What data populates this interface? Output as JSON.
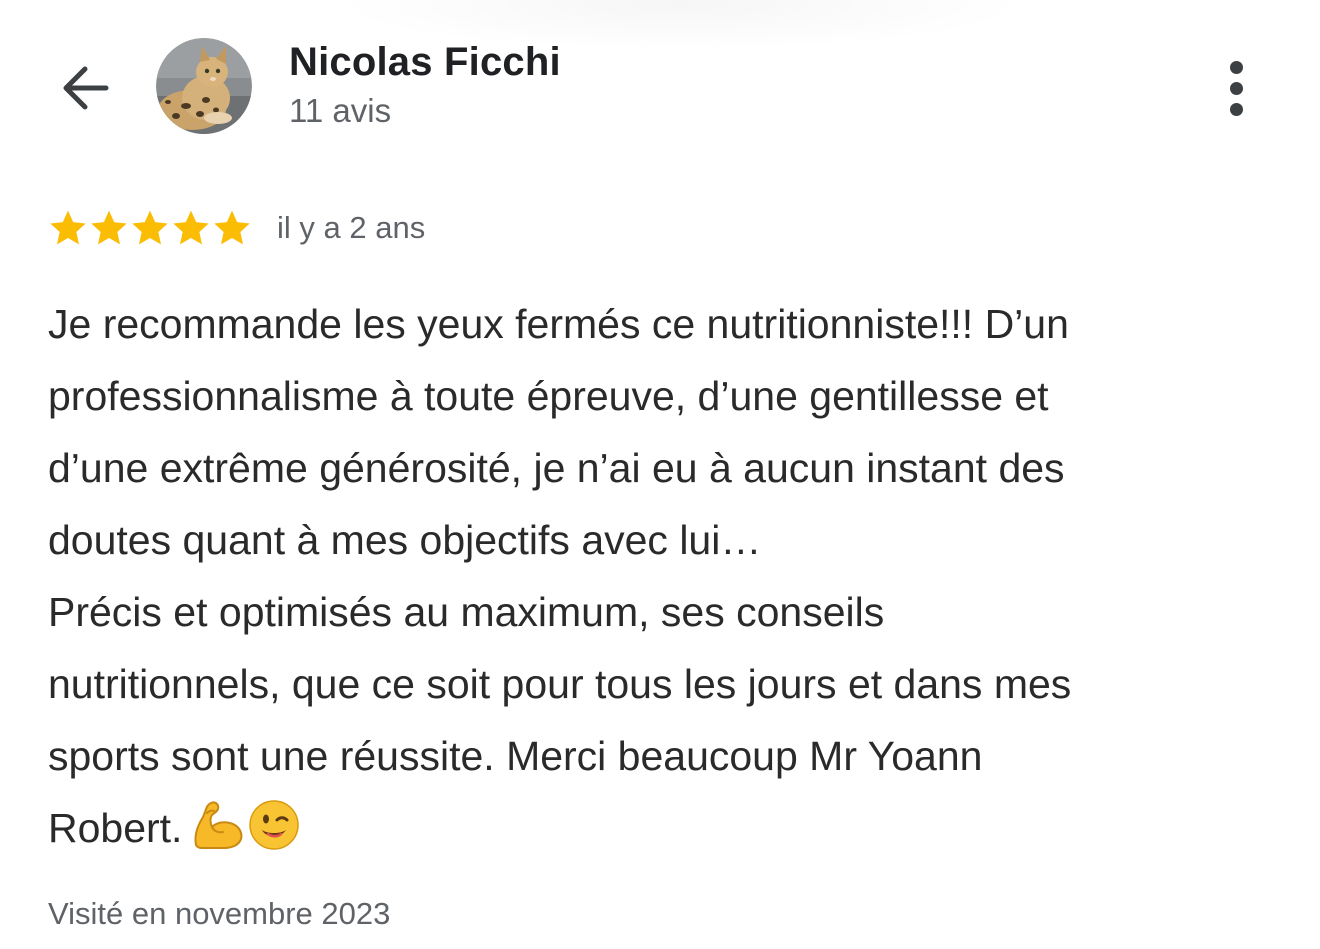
{
  "header": {
    "back_icon": "arrow-back-icon",
    "reviewer_name": "Nicolas Ficchi",
    "review_count": "11 avis",
    "more_icon": "more-vert-icon"
  },
  "review": {
    "rating": 5,
    "rating_max": 5,
    "star_color": "#FBBC04",
    "date": "il y a 2 ans",
    "lines": [
      "Je recommande les yeux fermés ce nutritionniste!!! D’un",
      "professionnalisme à toute épreuve, d’une gentillesse et",
      "d’une extrême générosité, je n’ai eu à aucun instant des",
      "doutes quant à mes objectifs avec lui…",
      "Précis et optimisés au maximum, ses conseils",
      "nutritionnels, que ce soit pour tous les jours et dans mes",
      "sports sont une réussite. Merci beaucoup Mr Yoann",
      "Robert."
    ],
    "emojis": [
      "flexed-biceps-icon",
      "winking-face-icon"
    ],
    "visit": "Visité en novembre 2023"
  }
}
